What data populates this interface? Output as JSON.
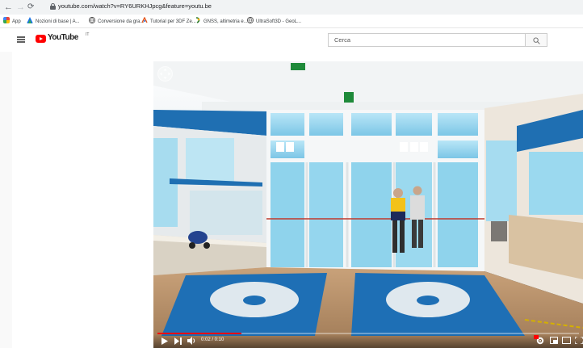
{
  "browser": {
    "url": "youtube.com/watch?v=RY6URKHJpcg&feature=youtu.be",
    "bookmarks": [
      {
        "label": "App",
        "icon": "apps-grid-icon",
        "color": "#e8453c"
      },
      {
        "label": "Nozioni di base | A...",
        "icon": "triangle-logo-icon",
        "color": "#1a73e8"
      },
      {
        "label": "Conversione da gra...",
        "icon": "globe-icon",
        "color": "#555555"
      },
      {
        "label": "Tutorial per 3DF Ze...",
        "icon": "tutorial-icon",
        "color": "#e25822"
      },
      {
        "label": "GNSS, altimetria e...",
        "icon": "gnss-icon",
        "color": "#2e7d32"
      },
      {
        "label": "UltraSoft3D - GeoL...",
        "icon": "globe-icon",
        "color": "#555555"
      }
    ]
  },
  "youtube": {
    "logo_text": "YouTube",
    "country_code": "IT",
    "search_placeholder": "Cerca"
  },
  "player": {
    "time_display": "0:02 / 0:10",
    "progress_fraction": 0.2,
    "colors": {
      "progress": "#ff0000",
      "floor_mat": "#1e6fb5",
      "glass": "#9fd8f0"
    }
  }
}
